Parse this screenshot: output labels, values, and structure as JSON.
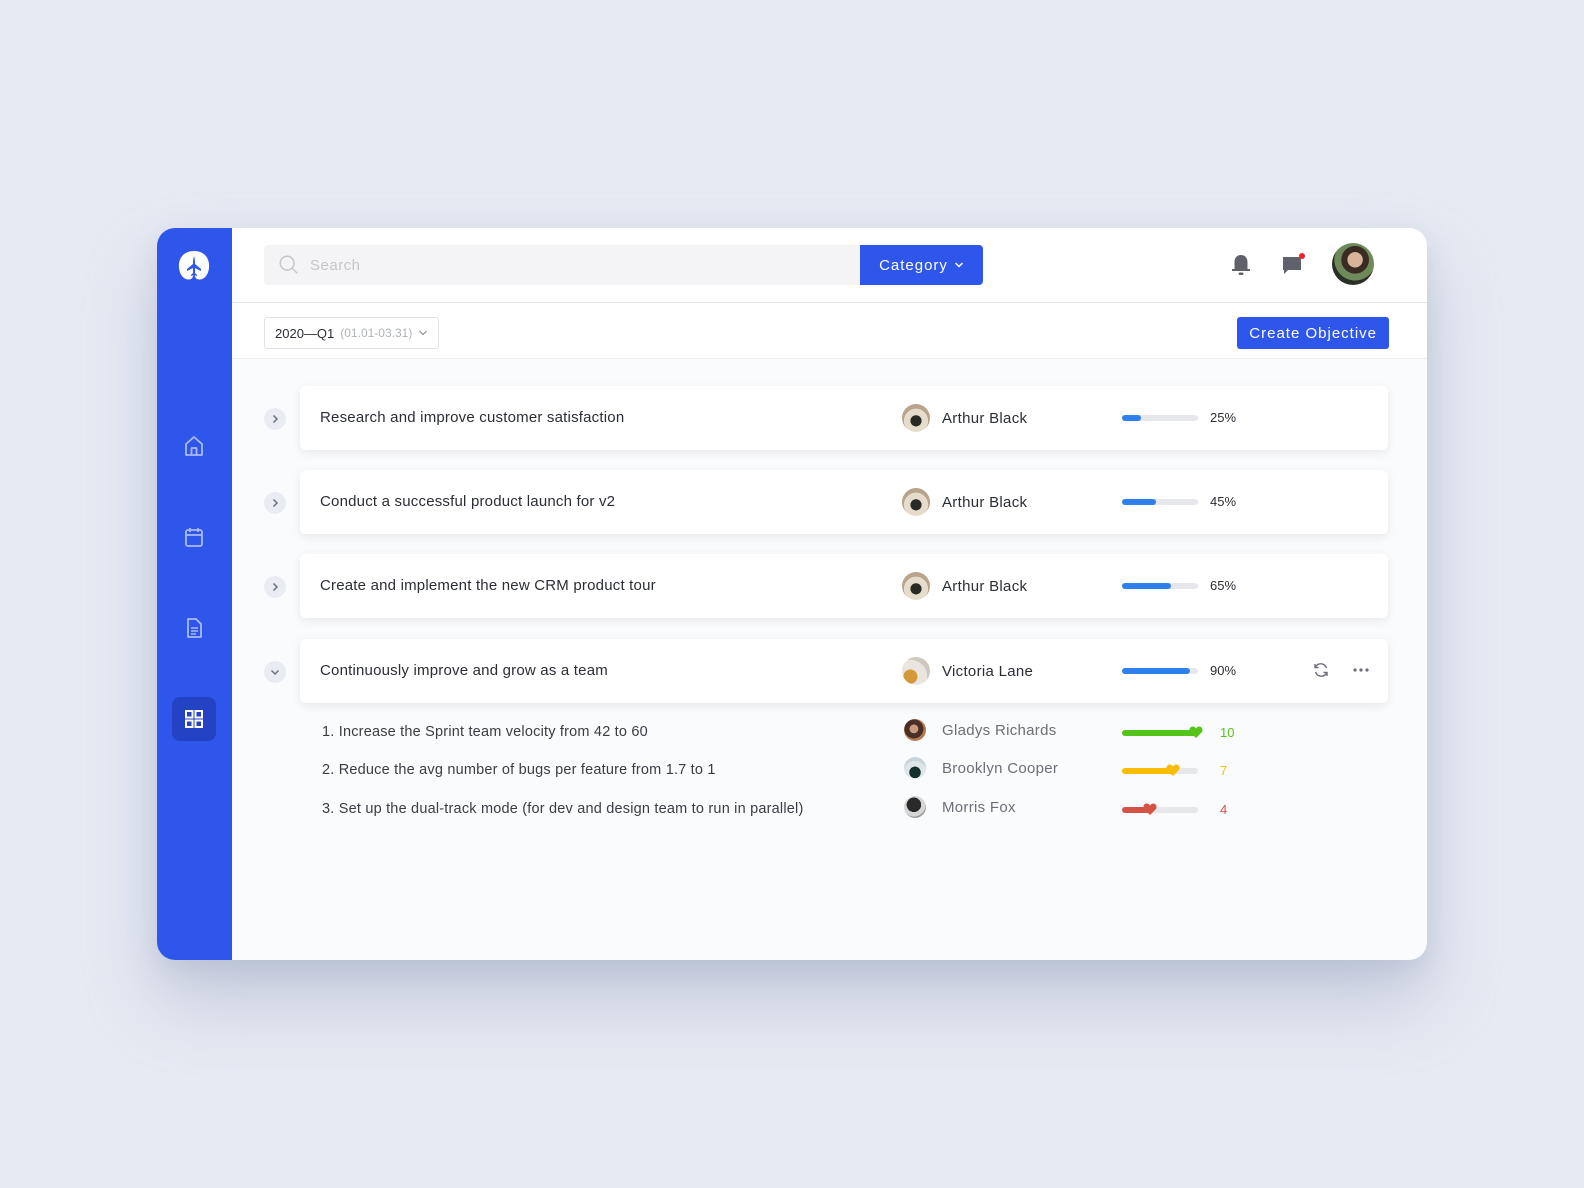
{
  "header": {
    "search_placeholder": "Search",
    "category_label": "Category",
    "icons": [
      "bell-icon",
      "chat-icon"
    ],
    "has_unread_messages": true
  },
  "filter": {
    "period_label": "2020—Q1",
    "period_range": "(01.01-03.31)",
    "create_label": "Create Objective"
  },
  "sidebar": {
    "items": [
      {
        "name": "home",
        "icon": "home-icon",
        "active": false
      },
      {
        "name": "calendar",
        "icon": "calendar-icon",
        "active": false
      },
      {
        "name": "documents",
        "icon": "document-icon",
        "active": false
      },
      {
        "name": "dashboard",
        "icon": "grid-icon",
        "active": true
      }
    ]
  },
  "objectives": [
    {
      "title": "Research and improve customer satisfaction",
      "owner": "Arthur Black",
      "progress": 25,
      "progress_label": "25%",
      "expanded": false
    },
    {
      "title": "Conduct a successful product launch for v2",
      "owner": "Arthur Black",
      "progress": 45,
      "progress_label": "45%",
      "expanded": false
    },
    {
      "title": "Create and implement the new CRM product tour",
      "owner": "Arthur Black",
      "progress": 65,
      "progress_label": "65%",
      "expanded": false
    },
    {
      "title": "Continuously improve and grow as a team",
      "owner": "Victoria Lane",
      "progress": 90,
      "progress_label": "90%",
      "expanded": true
    }
  ],
  "key_results": [
    {
      "title": "1. Increase the Sprint team velocity from 42 to 60",
      "owner": "Gladys Richards",
      "score": 10,
      "score_label": "10",
      "color": "#52c41a"
    },
    {
      "title": "2. Reduce the avg number of bugs per feature from 1.7 to 1",
      "owner": "Brooklyn Cooper",
      "score": 7,
      "score_label": "7",
      "color": "#fbbc05"
    },
    {
      "title": "3. Set up the dual-track mode (for dev and design team to run in parallel)",
      "owner": "Morris Fox",
      "score": 4,
      "score_label": "4",
      "color": "#d35445"
    }
  ],
  "colors": {
    "brand": "#2f56ea",
    "progress": "#2f80ed",
    "notification_dot": "#f5222d"
  }
}
